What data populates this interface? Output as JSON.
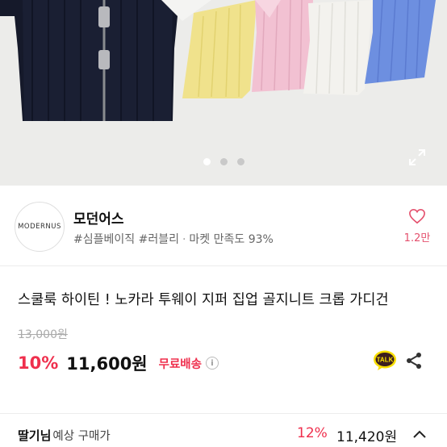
{
  "gallery": {
    "dots": 3,
    "active_index": 0
  },
  "seller": {
    "logo_text": "MODERNUS",
    "name": "모던어스",
    "tag1": "#심플베이직",
    "tag2": "#러블리",
    "satisfaction": "마켓 만족도 93%",
    "likes": "1.2만"
  },
  "product": {
    "title": "스쿨룩 하이틴 ! 노카라 투웨이 지퍼 집업 골지니트 크롭 가디건",
    "original_price": "13,000원",
    "discount": "10%",
    "price": "11,600원",
    "shipping": "무료배송",
    "info_mark": "i",
    "talk_label": "TALK"
  },
  "expected": {
    "nickname": "딸기님",
    "label": "예상 구매가",
    "discount": "12%",
    "price": "11,420원"
  },
  "colors": {
    "accent": "#ef2f4d",
    "like": "#e4506d",
    "kakao_yellow": "#f9e000"
  }
}
